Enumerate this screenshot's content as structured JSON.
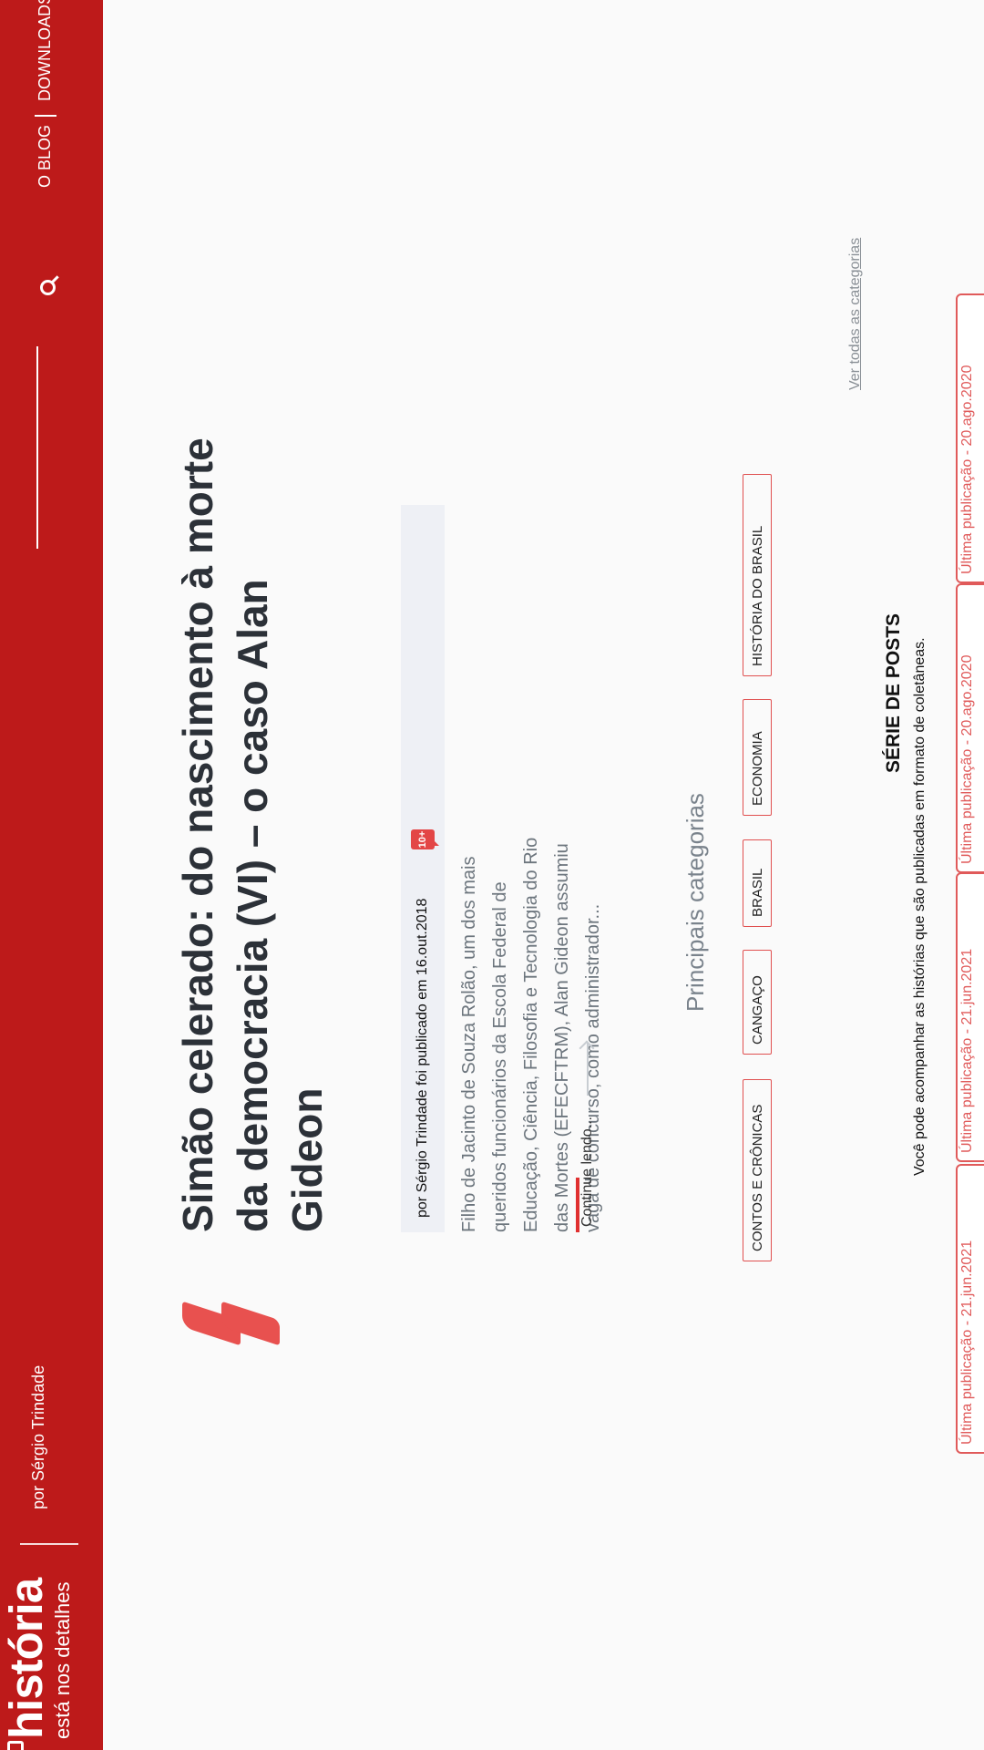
{
  "header": {
    "logo_text": "história",
    "tagline": "está nos detalhes",
    "author": "por Sérgio Trindade",
    "nav": [
      "O BLOG",
      "DOWNLOADS"
    ]
  },
  "post": {
    "title": "Simão celerado: do nascimento à morte da democracia (VI) – o caso Alan Gideon",
    "byline": "por Sérgio Trindade foi publicado em 16.out.2018",
    "comments_badge": "10+",
    "excerpt": "Filho de Jacinto de Souza Rolão, um dos mais queridos funcionários da Escola Federal de Educação, Ciência, Filosofia e Tecnologia do Rio das Mortes (EFECFTRM), Alan Gideon assumiu vaga de concurso, como administrador...",
    "continue_label": "Continue lendo..."
  },
  "categories": {
    "title": "Principais categorias",
    "items": [
      "CONTOS E CRÔNICAS",
      "CANGAÇO",
      "BRASIL",
      "ECONOMIA",
      "HISTÓRIA DO BRASIL"
    ],
    "see_all": "Ver todas as categorias"
  },
  "series": {
    "title": "SÉRIE DE POSTS",
    "description": "Você pode acompanhar as histórias que são publicadas em formato de coletâneas.",
    "cards": [
      {
        "last_published": "Última publicação - 21.jun.2021"
      },
      {
        "last_published": "Última publicação - 21.jun.2021"
      },
      {
        "last_published": "Última publicação - 20.ago.2020"
      },
      {
        "last_published": "Última publicação - 20.ago.2020"
      }
    ]
  },
  "colors": {
    "brand": "#bd1a1a",
    "accent": "#e8514f",
    "title": "#2c3138"
  }
}
